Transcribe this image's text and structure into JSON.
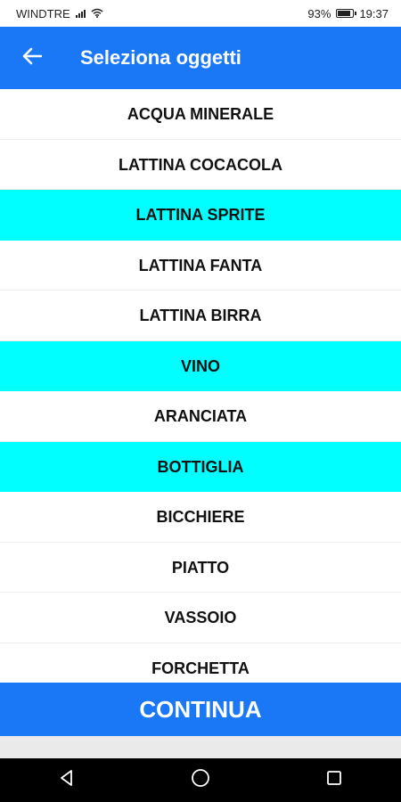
{
  "status_bar": {
    "carrier": "WINDTRE",
    "battery_percent": "93%",
    "battery_level": 0.93,
    "time": "19:37"
  },
  "app_bar": {
    "back_icon": "arrow-left-icon",
    "title": "Seleziona oggetti"
  },
  "items": [
    {
      "label": "ACQUA MINERALE",
      "selected": false
    },
    {
      "label": "LATTINA COCACOLA",
      "selected": false
    },
    {
      "label": "LATTINA SPRITE",
      "selected": true
    },
    {
      "label": "LATTINA FANTA",
      "selected": false
    },
    {
      "label": "LATTINA BIRRA",
      "selected": false
    },
    {
      "label": "VINO",
      "selected": true
    },
    {
      "label": "ARANCIATA",
      "selected": false
    },
    {
      "label": "BOTTIGLIA",
      "selected": true
    },
    {
      "label": "BICCHIERE",
      "selected": false
    },
    {
      "label": "PIATTO",
      "selected": false
    },
    {
      "label": "VASSOIO",
      "selected": false
    },
    {
      "label": "FORCHETTA",
      "selected": false
    }
  ],
  "continue_label": "CONTINUA",
  "colors": {
    "primary": "#1a78f7",
    "selected": "#00ffff"
  },
  "nav_bar": {
    "icons": [
      "back-triangle-icon",
      "home-circle-icon",
      "recents-square-icon"
    ]
  }
}
